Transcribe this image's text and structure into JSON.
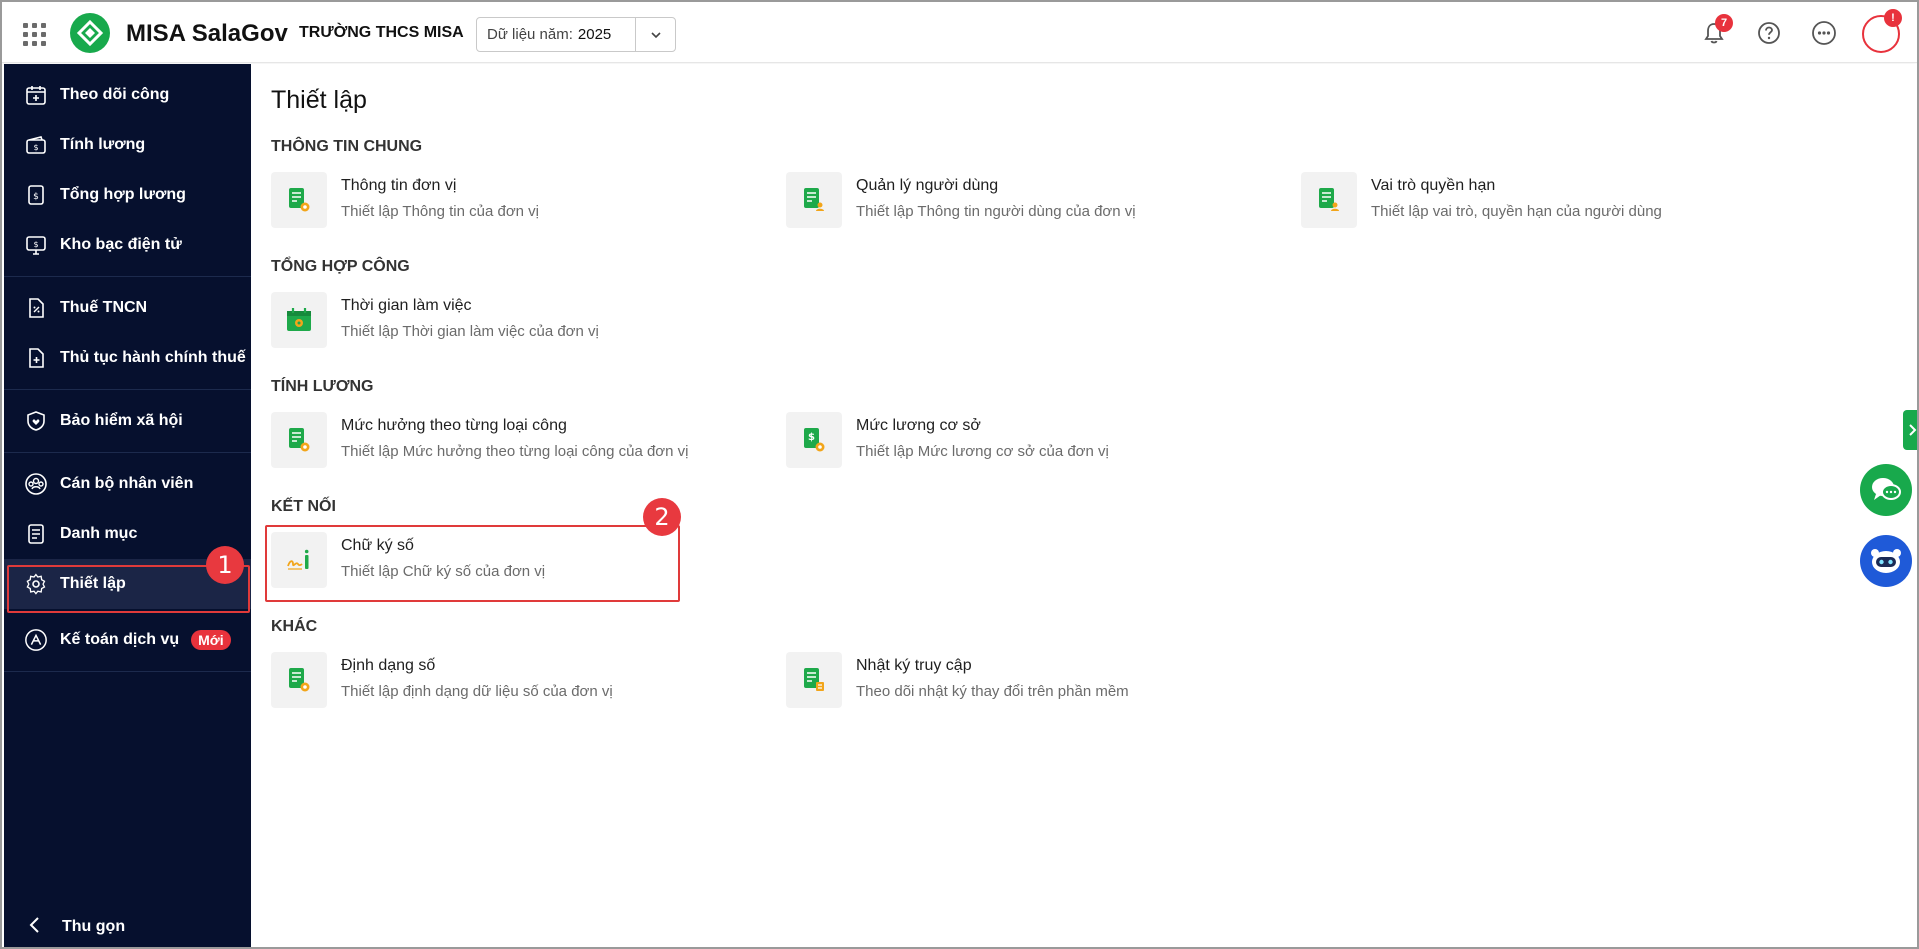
{
  "header": {
    "app_name": "MISA SalaGov",
    "org_name": "TRƯỜNG THCS MISA",
    "year_select": {
      "label": "Dữ liệu năm:",
      "value": "2025"
    },
    "notification_count": "7",
    "avatar_badge": "!"
  },
  "sidebar": {
    "groups": [
      [
        {
          "label": "Theo dõi công",
          "icon": "calendar-plus-icon"
        },
        {
          "label": "Tính lương",
          "icon": "wallet-icon"
        },
        {
          "label": "Tổng hợp lương",
          "icon": "salary-report-icon"
        },
        {
          "label": "Kho bạc điện tử",
          "icon": "treasury-icon"
        }
      ],
      [
        {
          "label": "Thuế TNCN",
          "icon": "tax-document-icon"
        },
        {
          "label": "Thủ tục hành chính thuế",
          "icon": "document-plus-icon"
        }
      ],
      [
        {
          "label": "Bảo hiểm xã hội",
          "icon": "shield-heart-icon"
        }
      ],
      [
        {
          "label": "Cán bộ nhân viên",
          "icon": "users-icon"
        },
        {
          "label": "Danh mục",
          "icon": "list-document-icon"
        },
        {
          "label": "Thiết lập",
          "icon": "gear-icon",
          "active": true
        },
        {
          "label": "Kế toán dịch vụ",
          "icon": "accounting-icon",
          "badge": "Mới"
        }
      ]
    ],
    "collapse_label": "Thu gọn"
  },
  "main": {
    "title": "Thiết lập",
    "sections": [
      {
        "title": "THÔNG TIN CHUNG",
        "items": [
          {
            "title": "Thông tin đơn vị",
            "desc": "Thiết lập Thông tin của đơn vị",
            "icon": "document-gear-icon"
          },
          {
            "title": "Quản lý người dùng",
            "desc": "Thiết lập Thông tin người dùng của đơn vị",
            "icon": "document-user-icon"
          },
          {
            "title": "Vai trò quyền hạn",
            "desc": "Thiết lập vai trò, quyền hạn của người dùng",
            "icon": "document-user-icon"
          }
        ]
      },
      {
        "title": "TỔNG HỢP CÔNG",
        "items": [
          {
            "title": "Thời gian làm việc",
            "desc": "Thiết lập Thời gian làm việc của đơn vị",
            "icon": "calendar-gear-icon"
          }
        ]
      },
      {
        "title": "TÍNH LƯƠNG",
        "items": [
          {
            "title": "Mức hưởng theo từng loại công",
            "desc": "Thiết lập Mức hưởng theo từng loại công của đơn vị",
            "icon": "document-gear-icon"
          },
          {
            "title": "Mức lương cơ sở",
            "desc": "Thiết lập Mức lương cơ sở của đơn vị",
            "icon": "document-dollar-icon"
          }
        ]
      },
      {
        "title": "KẾT NỐI",
        "items": [
          {
            "title": "Chữ ký số",
            "desc": "Thiết lập Chữ ký số của đơn vị",
            "icon": "signature-icon"
          }
        ]
      },
      {
        "title": "KHÁC",
        "items": [
          {
            "title": "Định dạng số",
            "desc": "Thiết lập định dạng dữ liệu số của đơn vị",
            "icon": "document-gear-icon"
          },
          {
            "title": "Nhật ký truy cập",
            "desc": "Theo dõi nhật ký thay đổi trên phần mềm",
            "icon": "document-list-icon"
          }
        ]
      }
    ]
  },
  "callouts": [
    "1",
    "2"
  ],
  "colors": {
    "sidebar_bg": "#06102e",
    "brand_green": "#18a94c",
    "alert_red": "#e8323c"
  }
}
